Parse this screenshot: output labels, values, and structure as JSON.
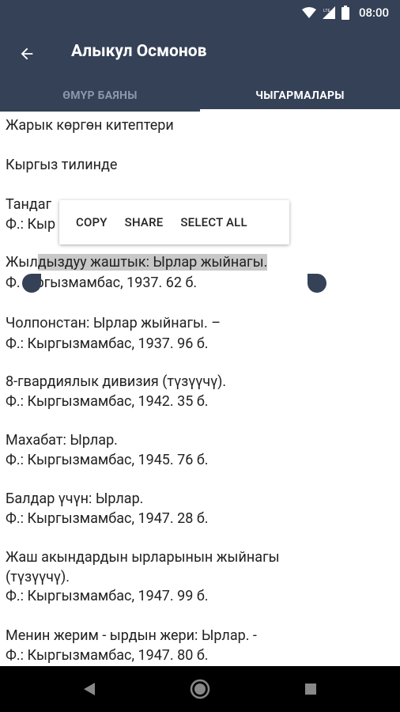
{
  "status": {
    "time": "08:00",
    "network": "LTE"
  },
  "app_bar": {
    "title": "Алыкул Осмонов"
  },
  "tabs": [
    {
      "label": "ӨМҮР БАЯНЫ",
      "active": false
    },
    {
      "label": "ЧЫГАРМАЛАРЫ",
      "active": true
    }
  ],
  "content": {
    "heading": "Жарык көргөн китептери",
    "subheading": "Кыргыз тилинде",
    "items": [
      {
        "line1": "Тандаг",
        "line2": "Ф.: Кыр"
      },
      {
        "line1_pre": "Жыл",
        "line1_sel": "дыздуу жаштык: Ырлар жыйнагы.",
        "line2_pre": "Ф.",
        "line2_rest": "ыргызмамбас, 1937.  62 б."
      },
      {
        "line1": "Чолпонстан: Ырлар жыйнагы. –",
        "line2": "Ф.: Кыргызмамбас, 1937.  96 б."
      },
      {
        "line1": "8-гвардиялык дивизия (түзүүчү).",
        "line2": "Ф.: Кыргызмамбас, 1942.  35 б."
      },
      {
        "line1": "Махабат: Ырлар.",
        "line2": "Ф.: Кыргызмамбас, 1945.  76 б."
      },
      {
        "line1": "Балдар үчүн: Ырлар.",
        "line2": "Ф.: Кыргызмамбас, 1947.  28 б."
      },
      {
        "line1": "Жаш акындардын ырларынын жыйнагы",
        "line2": "(түзүүчү).",
        "line3": "Ф.: Кыргызмамбас, 1947.  99 б."
      },
      {
        "line1": "Менин жерим - ырдын жери: Ырлар. -",
        "line2": "Ф.: Кыргызмамбас, 1947.  80 б."
      }
    ]
  },
  "popup": {
    "copy": "COPY",
    "share": "SHARE",
    "select_all": "SELECT ALL"
  },
  "colors": {
    "primary": "#344156",
    "selection": "#c8c8c8",
    "tab_inactive": "#8a97ad"
  }
}
